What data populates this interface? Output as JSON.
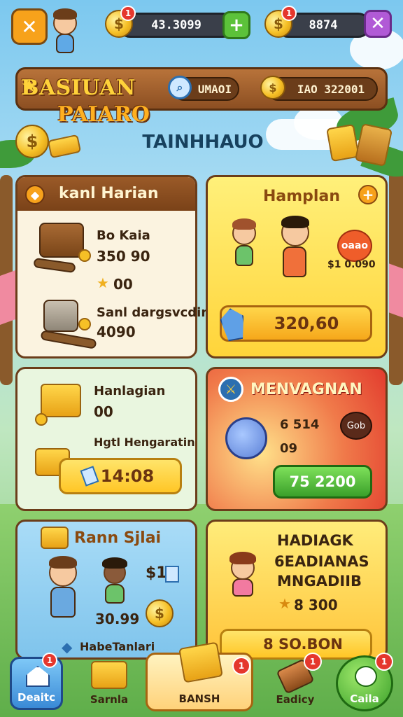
{
  "top_bar": {
    "close_label": "✕",
    "resource1": {
      "value": "43.3099",
      "badge": "1"
    },
    "resource2": {
      "value": "8874",
      "badge": "1"
    },
    "plus1_label": "+",
    "plus2_label": "✕"
  },
  "banner": {
    "title_line1": "BASIUAN",
    "title_line2": "PAIARO",
    "stat1": "UMAOI",
    "stat2": "IAO 322001",
    "section_heading": "TAINHHAUO"
  },
  "panels": {
    "p1": {
      "title": "kanl Harian",
      "item1_name": "Bo Kaia",
      "item1_val": "350 90",
      "item2_val": "00",
      "item3_name": "Sanl dargsvcdin",
      "item3_val": "4090"
    },
    "p2": {
      "title": "Hamplan",
      "offer_badge": "oaao",
      "offer_val": "$1 0.090",
      "button_label": "320,60"
    },
    "p3": {
      "title": "Hanlagian",
      "val": "00",
      "subtitle": "Hgtl Hengaratin",
      "button_label": "14:08"
    },
    "p4": {
      "title": "MENVAGNAN",
      "val1": "6 514",
      "tag": "Gob",
      "val2": "09",
      "button_label": "75 2200"
    },
    "p5": {
      "title": "Rann Sjlai",
      "price": "$1",
      "val": "30.99",
      "footer": "HabeTanlari"
    },
    "p6": {
      "title_line1": "HADIAGK",
      "title_line2": "6EADIANAS",
      "title_line3": "MNGADIIB",
      "val": "8 300",
      "button_label": "8 SO.BON"
    }
  },
  "nav": [
    {
      "label": "Deaitc",
      "badge": "1"
    },
    {
      "label": "Sarnla",
      "badge": ""
    },
    {
      "label": "BANSH",
      "badge": "1"
    },
    {
      "label": "Eadicy",
      "badge": "1"
    },
    {
      "label": "Caila",
      "badge": "1"
    }
  ],
  "colors": {
    "accent_orange": "#f7a21b",
    "accent_green": "#5cc23a",
    "accent_purple": "#b15ad6",
    "panel_red": "#e94b3c",
    "panel_yellow": "#ffd64a"
  }
}
